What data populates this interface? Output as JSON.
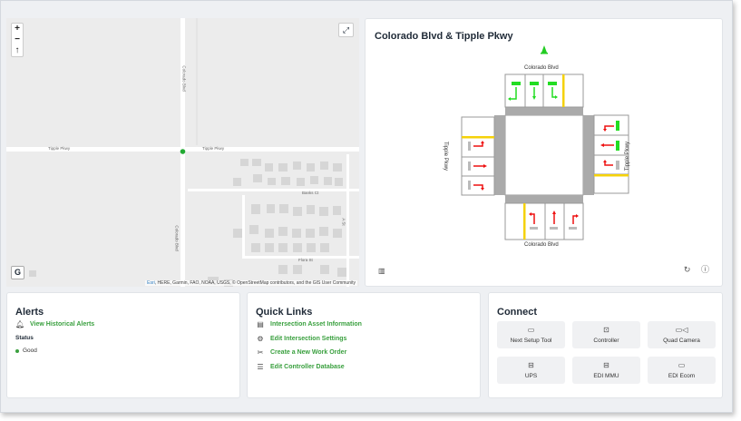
{
  "intersection": {
    "title": "Colorado Blvd & Tipple Pkwy",
    "north_label": "Colorado Blvd",
    "south_label": "Colorado Blvd",
    "west_label": "Tipple Pkwy",
    "east_label": "Tipple Pkwy"
  },
  "map": {
    "zoom_in": "+",
    "zoom_out": "−",
    "reset": "↑",
    "google_button": "G",
    "attribution_esri": "Esri",
    "attribution_rest": ", HERE, Garmin, FAO, NOAA, USGS, © OpenStreetMap contributors, and the GIS User Community",
    "labels": {
      "tipple_west": "Tipple Pkwy",
      "tipple_east": "Tipple Pkwy",
      "colorado_north": "Colorado Blvd",
      "colorado_south": "Colorado Blvd",
      "side_st": "Banks Ct",
      "side_ave": "A St",
      "lower_st": "Flora St"
    }
  },
  "alerts": {
    "title": "Alerts",
    "link": "View Historical Alerts",
    "status_label": "Status",
    "status_value": "Good",
    "status_color": "#3aa03f"
  },
  "quick_links": {
    "title": "Quick Links",
    "items": [
      {
        "label": "Intersection Asset Information",
        "icon": "id-card-icon"
      },
      {
        "label": "Edit Intersection Settings",
        "icon": "gear-icon"
      },
      {
        "label": "Create a New Work Order",
        "icon": "tools-icon"
      },
      {
        "label": "Edit Controller Database",
        "icon": "database-icon"
      }
    ]
  },
  "connect": {
    "title": "Connect",
    "tiles": [
      {
        "label": "Next Setup Tool",
        "icon": "monitor-icon"
      },
      {
        "label": "Controller",
        "icon": "terminal-icon"
      },
      {
        "label": "Quad Camera",
        "icon": "camera-icon"
      },
      {
        "label": "UPS",
        "icon": "ups-icon"
      },
      {
        "label": "EDI MMU",
        "icon": "mmu-icon"
      },
      {
        "label": "EDI Ecom",
        "icon": "monitor-icon"
      }
    ]
  },
  "colors": {
    "accent": "#3aa03f",
    "signal_green": "#22dd22",
    "signal_red": "#ee1111",
    "crosswalk_yellow": "#f5d20a"
  }
}
